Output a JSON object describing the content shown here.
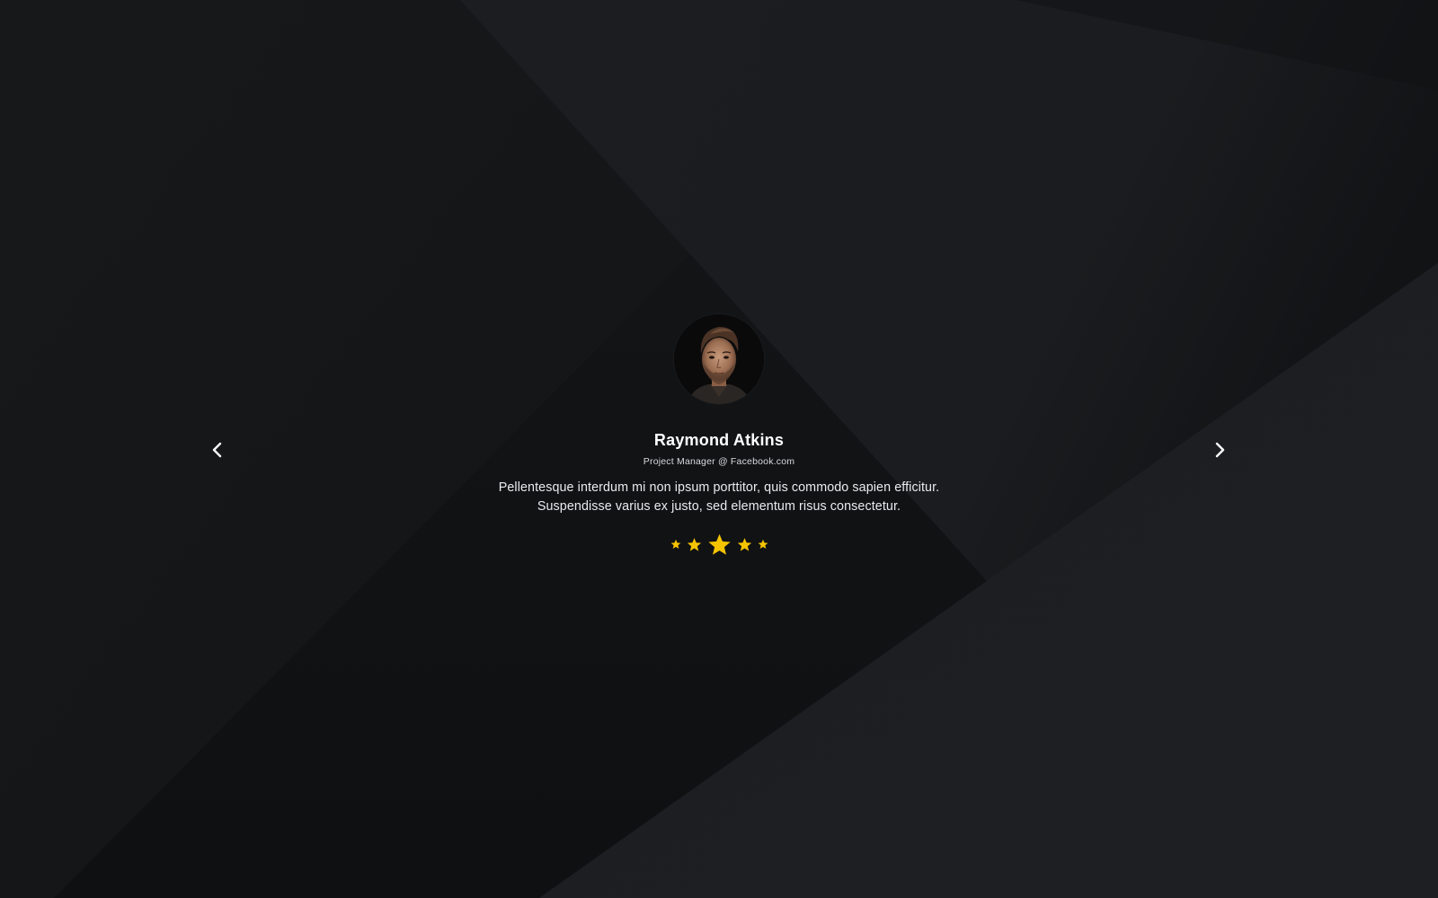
{
  "testimonial": {
    "name": "Raymond Atkins",
    "role": "Project Manager @ Facebook.com",
    "quote_line_1": "Pellentesque interdum mi non ipsum porttitor, quis commodo sapien efficitur.",
    "quote_line_2": "Suspendisse varius ex justo, sed elementum risus consectetur.",
    "rating": 5,
    "rating_max": 5
  },
  "navigation": {
    "prev_icon": "chevron-left-icon",
    "next_icon": "chevron-right-icon"
  },
  "colors": {
    "star": "#f5c400",
    "text": "#ffffff",
    "background": "#17191c"
  }
}
